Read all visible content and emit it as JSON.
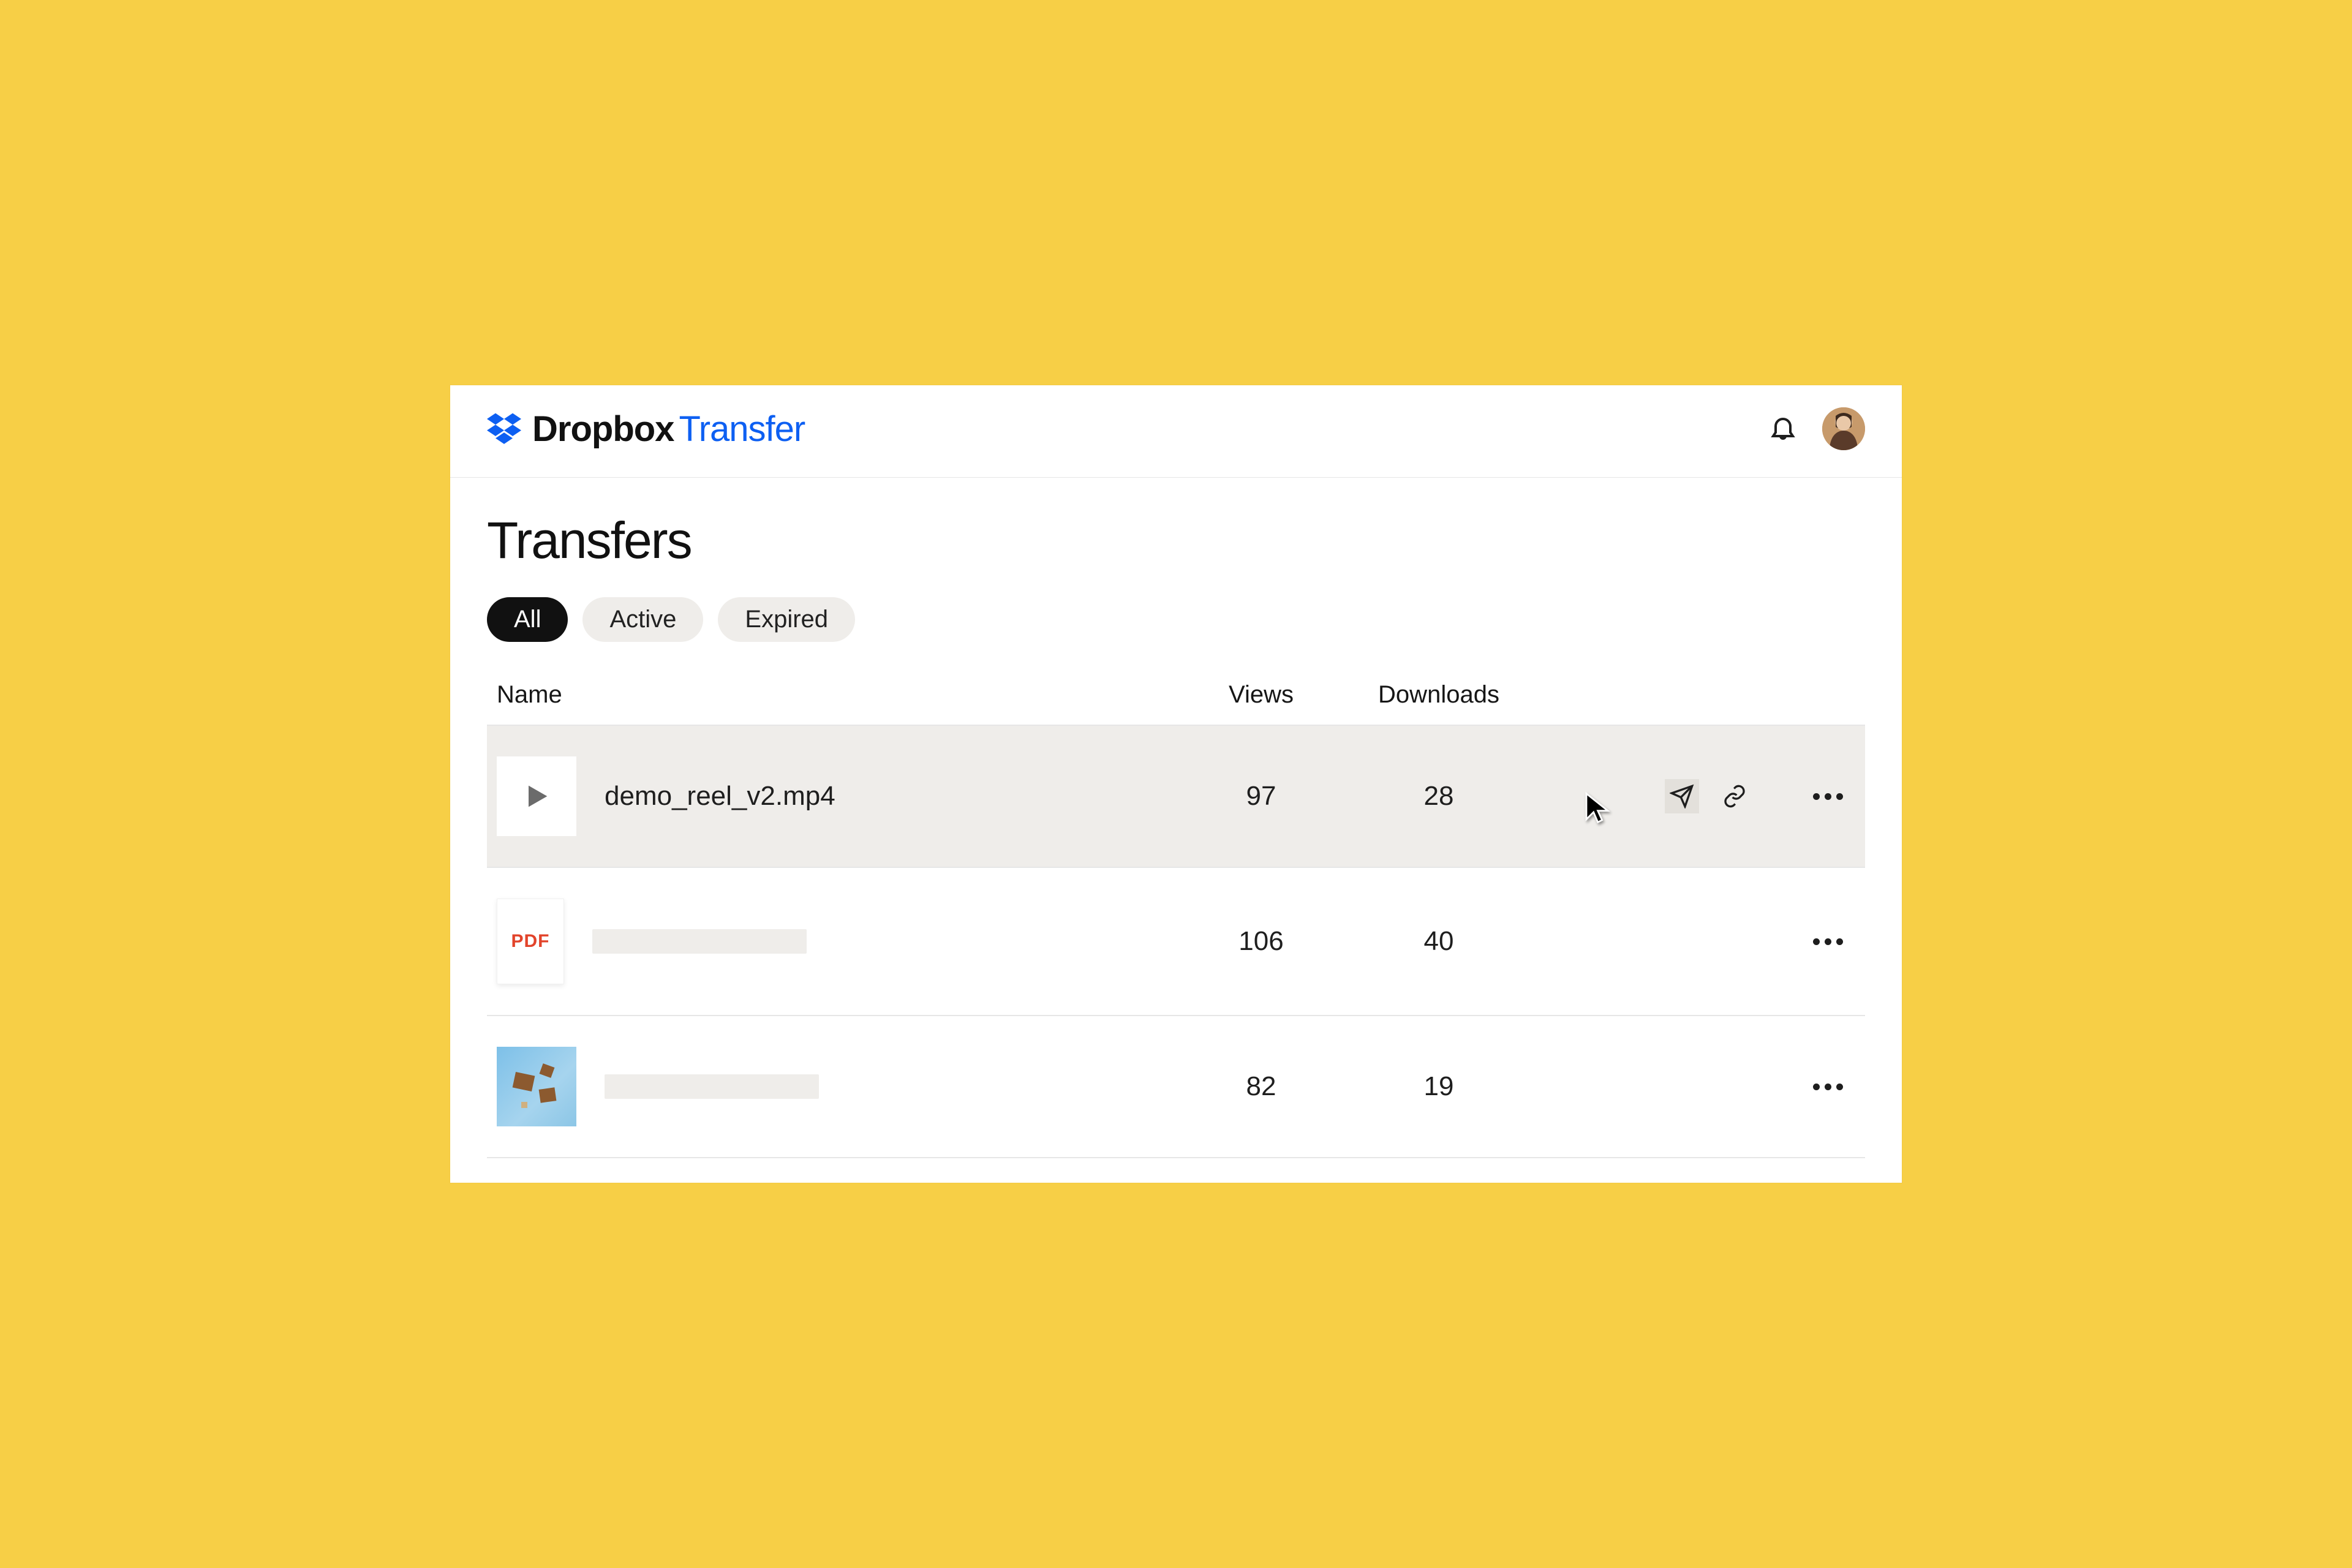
{
  "brand": {
    "name": "Dropbox",
    "sub": "Transfer"
  },
  "page_title": "Transfers",
  "filters": [
    {
      "label": "All",
      "active": true
    },
    {
      "label": "Active",
      "active": false
    },
    {
      "label": "Expired",
      "active": false
    }
  ],
  "columns": {
    "name": "Name",
    "views": "Views",
    "downloads": "Downloads"
  },
  "rows": [
    {
      "type": "video",
      "filename": "demo_reel_v2.mp4",
      "views": "97",
      "downloads": "28",
      "hovered": true
    },
    {
      "type": "pdf",
      "filename": "",
      "views": "106",
      "downloads": "40",
      "hovered": false
    },
    {
      "type": "image",
      "filename": "",
      "views": "82",
      "downloads": "19",
      "hovered": false
    }
  ],
  "icons": {
    "pdf_label": "PDF"
  }
}
